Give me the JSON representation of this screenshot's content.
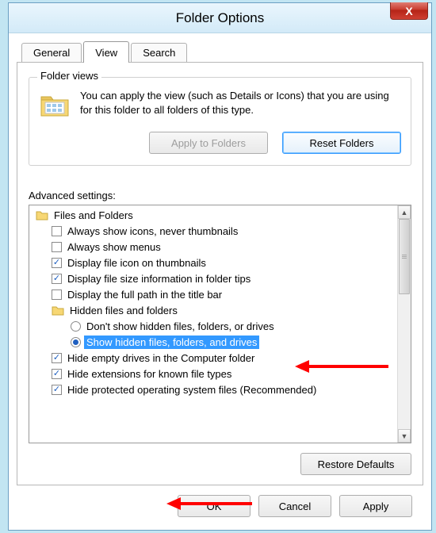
{
  "window": {
    "title": "Folder Options",
    "close_label": "X"
  },
  "tabs": {
    "general": "General",
    "view": "View",
    "search": "Search"
  },
  "folder_views": {
    "group_title": "Folder views",
    "description": "You can apply the view (such as Details or Icons) that you are using for this folder to all folders of this type.",
    "apply_label": "Apply to Folders",
    "reset_label": "Reset Folders"
  },
  "advanced": {
    "label": "Advanced settings:",
    "restore_label": "Restore Defaults",
    "root": "Files and Folders",
    "items": [
      {
        "kind": "checkbox",
        "checked": false,
        "label": "Always show icons, never thumbnails"
      },
      {
        "kind": "checkbox",
        "checked": false,
        "label": "Always show menus"
      },
      {
        "kind": "checkbox",
        "checked": true,
        "label": "Display file icon on thumbnails"
      },
      {
        "kind": "checkbox",
        "checked": true,
        "label": "Display file size information in folder tips"
      },
      {
        "kind": "checkbox",
        "checked": false,
        "label": "Display the full path in the title bar"
      }
    ],
    "hidden_group": "Hidden files and folders",
    "hidden_options": [
      {
        "checked": false,
        "label": "Don't show hidden files, folders, or drives"
      },
      {
        "checked": true,
        "label": "Show hidden files, folders, and drives"
      }
    ],
    "tail": [
      {
        "kind": "checkbox",
        "checked": true,
        "label": "Hide empty drives in the Computer folder"
      },
      {
        "kind": "checkbox",
        "checked": true,
        "label": "Hide extensions for known file types"
      },
      {
        "kind": "checkbox",
        "checked": true,
        "label": "Hide protected operating system files (Recommended)"
      }
    ]
  },
  "buttons": {
    "ok": "OK",
    "cancel": "Cancel",
    "apply": "Apply"
  }
}
